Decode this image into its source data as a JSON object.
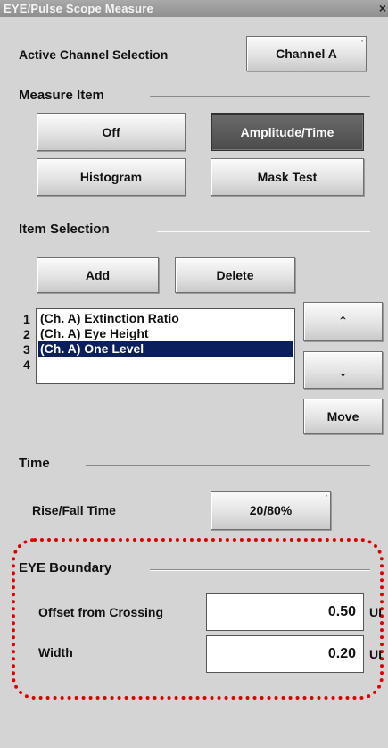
{
  "window": {
    "title": "EYE/Pulse Scope Measure",
    "close_glyph": "×"
  },
  "active_channel": {
    "label": "Active Channel Selection",
    "button": "Channel A"
  },
  "measure_item": {
    "heading": "Measure Item",
    "buttons": [
      {
        "label": "Off",
        "active": false
      },
      {
        "label": "Amplitude/Time",
        "active": true
      },
      {
        "label": "Histogram",
        "active": false
      },
      {
        "label": "Mask Test",
        "active": false
      }
    ]
  },
  "item_selection": {
    "heading": "Item Selection",
    "add": "Add",
    "delete": "Delete",
    "rows": [
      {
        "num": "1",
        "text": "(Ch. A) Extinction Ratio",
        "selected": false
      },
      {
        "num": "2",
        "text": "(Ch. A) Eye Height",
        "selected": false
      },
      {
        "num": "3",
        "text": "(Ch. A) One Level",
        "selected": true
      },
      {
        "num": "4",
        "text": "",
        "selected": false
      }
    ],
    "up_icon": "arrow-up-icon",
    "down_icon": "arrow-down-icon",
    "up_glyph": "↑",
    "down_glyph": "↓",
    "move": "Move"
  },
  "time": {
    "heading": "Time",
    "rise_fall_label": "Rise/Fall Time",
    "rise_fall_value": "20/80%"
  },
  "eye_boundary": {
    "heading": "EYE Boundary",
    "offset_label": "Offset from Crossing",
    "offset_value": "0.50",
    "offset_unit": "UI",
    "width_label": "Width",
    "width_value": "0.20",
    "width_unit": "UI"
  },
  "colors": {
    "highlight": "#e00000",
    "selection": "#0b1f5c",
    "active_button": "#4b4b4b"
  }
}
